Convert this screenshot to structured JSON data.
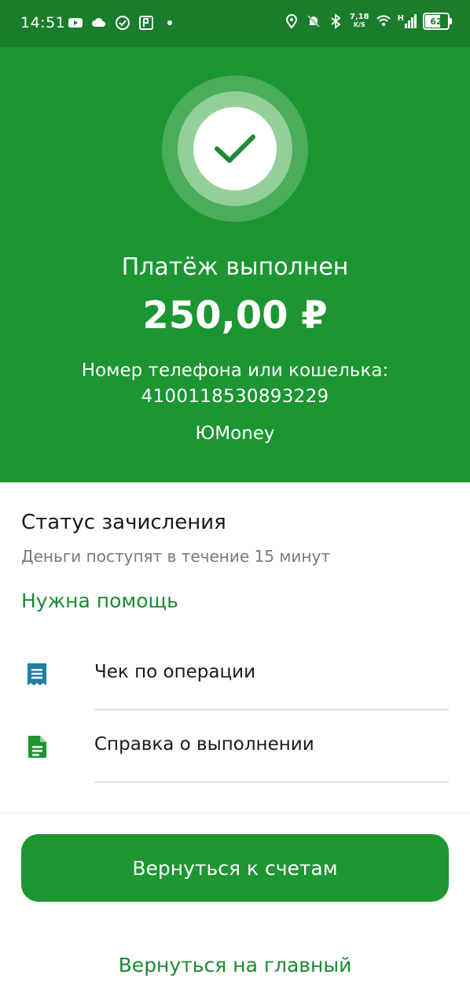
{
  "status_bar": {
    "time": "14:51",
    "network_speed_value": "7,18",
    "network_speed_unit": "K/S",
    "network_type": "H",
    "battery": "62",
    "left_icons": [
      "youtube-icon",
      "cloud-icon",
      "check-circle-icon",
      "app-icon",
      "dot-icon"
    ],
    "right_icons": [
      "location-icon",
      "bell-off-icon",
      "bluetooth-icon",
      "wifi-icon",
      "signal-icon",
      "battery-icon"
    ]
  },
  "hero": {
    "title": "Платёж выполнен",
    "amount": "250,00 ₽",
    "recipient_label": "Номер телефона или кошелька:",
    "recipient_number": "4100118530893229",
    "service": "ЮMoney",
    "icon": "checkmark-icon"
  },
  "content": {
    "status_title": "Статус зачисления",
    "status_subtitle": "Деньги поступят в течение 15 минут",
    "help_link": "Нужна помощь",
    "items": [
      {
        "label": "Чек по операции",
        "icon": "receipt-icon"
      },
      {
        "label": "Справка о выполнении",
        "icon": "document-icon"
      },
      {
        "label": "",
        "icon": "share-icon"
      }
    ]
  },
  "actions": {
    "primary": "Вернуться к счетам",
    "secondary": "Вернуться на главный"
  },
  "colors": {
    "status_bar": "#1a7d2c",
    "hero_bg": "#1c9632",
    "accent": "#1a8a31",
    "receipt_icon": "#1f7fa0",
    "document_icon": "#1e9632"
  }
}
